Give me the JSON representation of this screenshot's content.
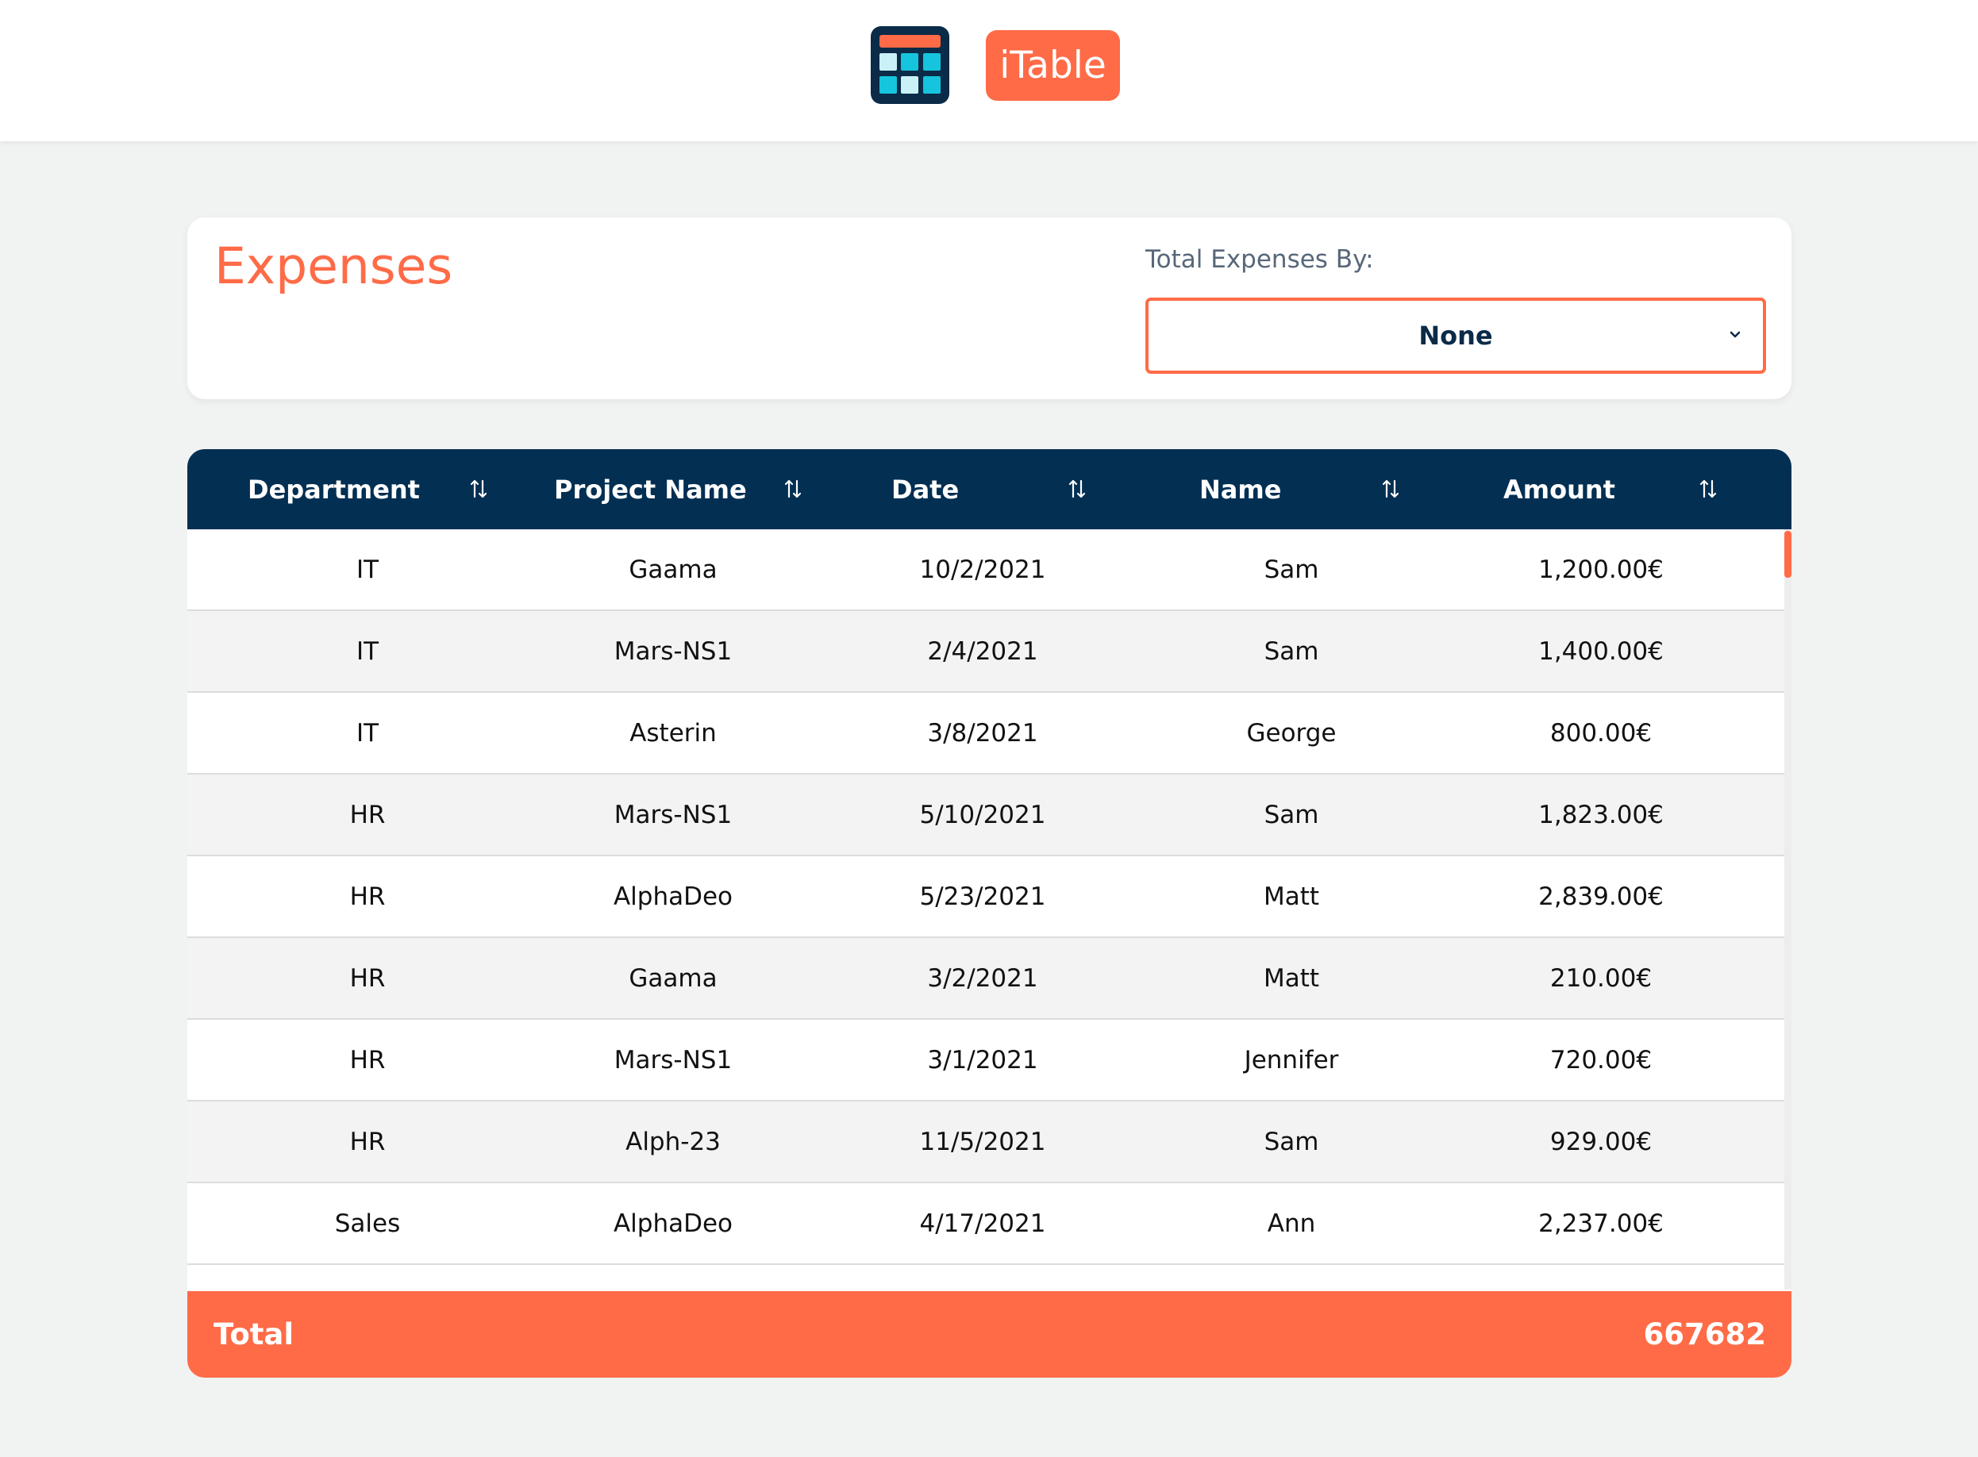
{
  "header": {
    "brand": "iTable",
    "logo_icon": "table-icon"
  },
  "card": {
    "title": "Expenses",
    "select_label": "Total Expenses By:",
    "select_value": "None"
  },
  "table": {
    "columns": [
      "Department",
      "Project Name",
      "Date",
      "Name",
      "Amount"
    ],
    "rows": [
      [
        "IT",
        "Gaama",
        "10/2/2021",
        "Sam",
        "1,200.00€"
      ],
      [
        "IT",
        "Mars-NS1",
        "2/4/2021",
        "Sam",
        "1,400.00€"
      ],
      [
        "IT",
        "Asterin",
        "3/8/2021",
        "George",
        "800.00€"
      ],
      [
        "HR",
        "Mars-NS1",
        "5/10/2021",
        "Sam",
        "1,823.00€"
      ],
      [
        "HR",
        "AlphaDeo",
        "5/23/2021",
        "Matt",
        "2,839.00€"
      ],
      [
        "HR",
        "Gaama",
        "3/2/2021",
        "Matt",
        "210.00€"
      ],
      [
        "HR",
        "Mars-NS1",
        "3/1/2021",
        "Jennifer",
        "720.00€"
      ],
      [
        "HR",
        "Alph-23",
        "11/5/2021",
        "Sam",
        "929.00€"
      ],
      [
        "Sales",
        "AlphaDeo",
        "4/17/2021",
        "Ann",
        "2,237.00€"
      ]
    ],
    "footer_label": "Total",
    "footer_value": "667682"
  },
  "colors": {
    "accent": "#ff6b47",
    "navy": "#032f52",
    "background": "#f1f2f2"
  }
}
